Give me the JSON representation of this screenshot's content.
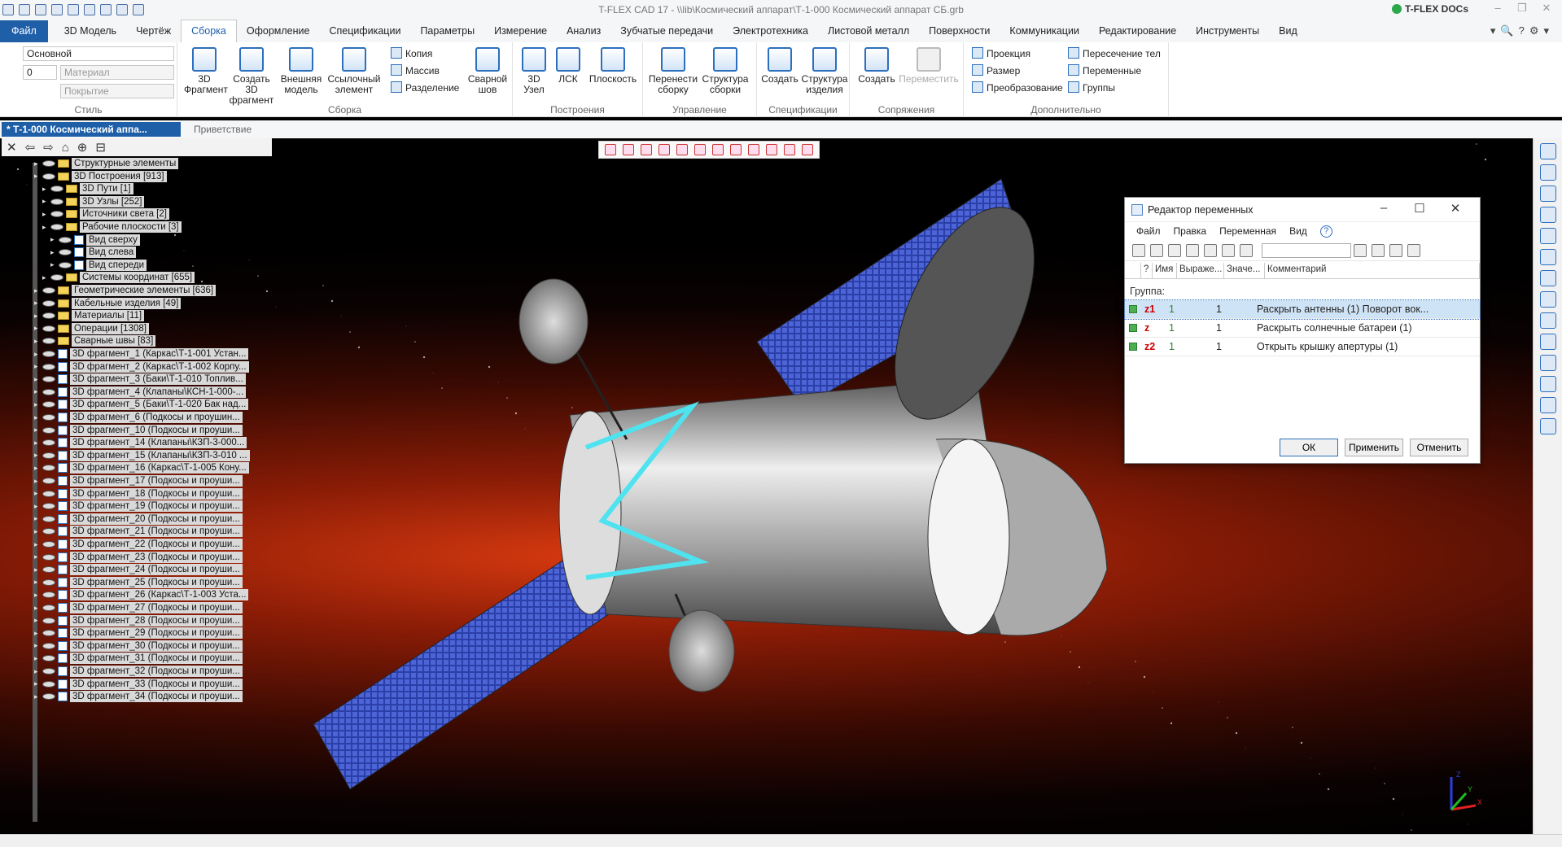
{
  "window": {
    "title": "T-FLEX CAD 17 - \\\\lib\\Космический аппарат\\Т-1-000 Космический аппарат СБ.grb",
    "docs": "T-FLEX DOCs"
  },
  "tabs": [
    "Файл",
    "3D Модель",
    "Чертёж",
    "Сборка",
    "Оформление",
    "Спецификации",
    "Параметры",
    "Измерение",
    "Анализ",
    "Зубчатые передачи",
    "Электротехника",
    "Листовой металл",
    "Поверхности",
    "Коммуникации",
    "Редактирование",
    "Инструменты",
    "Вид"
  ],
  "ribbon": {
    "style": {
      "label": "Стиль",
      "layer": "Основной",
      "level": "0",
      "material": "Материал",
      "coating": "Покрытие"
    },
    "assembly": {
      "label": "Сборка",
      "b1": "3D Фрагмент",
      "b2": "Создать 3D фрагмент",
      "b3": "Внешняя модель",
      "b4": "Ссылочный элемент",
      "s1": "Копия",
      "s2": "Массив",
      "s3": "Разделение",
      "b5": "Сварной шов"
    },
    "build": {
      "label": "Построения",
      "b1": "3D Узел",
      "b2": "ЛСК",
      "b3": "Плоскость"
    },
    "control": {
      "label": "Управление",
      "b1": "Перенести сборку",
      "b2": "Структура сборки"
    },
    "spec": {
      "label": "Спецификации",
      "b1": "Создать",
      "b2": "Структура изделия"
    },
    "mates": {
      "label": "Сопряжения",
      "b1": "Создать",
      "b2": "Переместить"
    },
    "extra": {
      "label": "Дополнительно",
      "s1": "Проекция",
      "s2": "Размер",
      "s3": "Преобразование",
      "s4": "Пересечение тел",
      "s5": "Переменные",
      "s6": "Группы"
    }
  },
  "doctabs": {
    "active": "* Т-1-000 Космический аппа...",
    "welcome": "Приветствие"
  },
  "tree": [
    {
      "t": "Структурные элементы",
      "lvl": 0,
      "k": "fold"
    },
    {
      "t": "3D Построения [913]",
      "lvl": 0,
      "k": "fold"
    },
    {
      "t": "3D Пути [1]",
      "lvl": 1,
      "k": "fold"
    },
    {
      "t": "3D Узлы [252]",
      "lvl": 1,
      "k": "fold"
    },
    {
      "t": "Источники света [2]",
      "lvl": 1,
      "k": "fold"
    },
    {
      "t": "Рабочие плоскости [3]",
      "lvl": 1,
      "k": "fold"
    },
    {
      "t": "Вид сверху",
      "lvl": 2,
      "k": "frag"
    },
    {
      "t": "Вид слева",
      "lvl": 2,
      "k": "frag"
    },
    {
      "t": "Вид спереди",
      "lvl": 2,
      "k": "frag"
    },
    {
      "t": "Системы координат [655]",
      "lvl": 1,
      "k": "fold"
    },
    {
      "t": "Геометрические элементы [636]",
      "lvl": 0,
      "k": "fold"
    },
    {
      "t": "Кабельные изделия [49]",
      "lvl": 0,
      "k": "fold"
    },
    {
      "t": "Материалы [11]",
      "lvl": 0,
      "k": "fold"
    },
    {
      "t": "Операции [1308]",
      "lvl": 0,
      "k": "fold"
    },
    {
      "t": "Сварные швы [83]",
      "lvl": 0,
      "k": "fold"
    },
    {
      "t": "3D фрагмент_1 (Каркас\\Т-1-001 Устан...",
      "lvl": 0,
      "k": "frag"
    },
    {
      "t": "3D фрагмент_2 (Каркас\\Т-1-002 Корпу...",
      "lvl": 0,
      "k": "frag"
    },
    {
      "t": "3D фрагмент_3 (Баки\\Т-1-010 Топлив...",
      "lvl": 0,
      "k": "frag"
    },
    {
      "t": "3D фрагмент_4 (Клапаны\\КСН-1-000-...",
      "lvl": 0,
      "k": "frag"
    },
    {
      "t": "3D фрагмент_5 (Баки\\Т-1-020 Бак над...",
      "lvl": 0,
      "k": "frag"
    },
    {
      "t": "3D фрагмент_6 (Подкосы и проушин...",
      "lvl": 0,
      "k": "frag"
    },
    {
      "t": "3D фрагмент_10 (Подкосы и проуши...",
      "lvl": 0,
      "k": "frag"
    },
    {
      "t": "3D фрагмент_14 (Клапаны\\КЗП-3-000...",
      "lvl": 0,
      "k": "frag"
    },
    {
      "t": "3D фрагмент_15 (Клапаны\\КЗП-3-010 ...",
      "lvl": 0,
      "k": "frag"
    },
    {
      "t": "3D фрагмент_16 (Каркас\\Т-1-005 Кону...",
      "lvl": 0,
      "k": "frag"
    },
    {
      "t": "3D фрагмент_17 (Подкосы и проуши...",
      "lvl": 0,
      "k": "frag"
    },
    {
      "t": "3D фрагмент_18 (Подкосы и проуши...",
      "lvl": 0,
      "k": "frag"
    },
    {
      "t": "3D фрагмент_19 (Подкосы и проуши...",
      "lvl": 0,
      "k": "frag"
    },
    {
      "t": "3D фрагмент_20 (Подкосы и проуши...",
      "lvl": 0,
      "k": "frag"
    },
    {
      "t": "3D фрагмент_21 (Подкосы и проуши...",
      "lvl": 0,
      "k": "frag"
    },
    {
      "t": "3D фрагмент_22 (Подкосы и проуши...",
      "lvl": 0,
      "k": "frag"
    },
    {
      "t": "3D фрагмент_23 (Подкосы и проуши...",
      "lvl": 0,
      "k": "frag"
    },
    {
      "t": "3D фрагмент_24 (Подкосы и проуши...",
      "lvl": 0,
      "k": "frag"
    },
    {
      "t": "3D фрагмент_25 (Подкосы и проуши...",
      "lvl": 0,
      "k": "frag"
    },
    {
      "t": "3D фрагмент_26 (Каркас\\Т-1-003 Уста...",
      "lvl": 0,
      "k": "frag"
    },
    {
      "t": "3D фрагмент_27 (Подкосы и проуши...",
      "lvl": 0,
      "k": "frag"
    },
    {
      "t": "3D фрагмент_28 (Подкосы и проуши...",
      "lvl": 0,
      "k": "frag"
    },
    {
      "t": "3D фрагмент_29 (Подкосы и проуши...",
      "lvl": 0,
      "k": "frag"
    },
    {
      "t": "3D фрагмент_30 (Подкосы и проуши...",
      "lvl": 0,
      "k": "frag"
    },
    {
      "t": "3D фрагмент_31 (Подкосы и проуши...",
      "lvl": 0,
      "k": "frag"
    },
    {
      "t": "3D фрагмент_32 (Подкосы и проуши...",
      "lvl": 0,
      "k": "frag"
    },
    {
      "t": "3D фрагмент_33 (Подкосы и проуши...",
      "lvl": 0,
      "k": "frag"
    },
    {
      "t": "3D фрагмент_34 (Подкосы и проуши...",
      "lvl": 0,
      "k": "frag"
    }
  ],
  "dialog": {
    "title": "Редактор переменных",
    "menu": [
      "Файл",
      "Правка",
      "Переменная",
      "Вид"
    ],
    "help": "?",
    "columns": [
      "Имя",
      "Выраже...",
      "Значе...",
      "Комментарий"
    ],
    "group": "Группа:",
    "rows": [
      {
        "name": "z1",
        "expr": "1",
        "value": "1",
        "comment": "Раскрыть антенны (1) Поворот вок..."
      },
      {
        "name": "z",
        "expr": "1",
        "value": "1",
        "comment": "Раскрыть солнечные батареи (1)"
      },
      {
        "name": "z2",
        "expr": "1",
        "value": "1",
        "comment": "Открыть крышку апертуры (1)"
      }
    ],
    "ok": "ОК",
    "apply": "Применить",
    "cancel": "Отменить"
  },
  "axis": {
    "z": "Z",
    "x": "X",
    "y": "Y"
  }
}
